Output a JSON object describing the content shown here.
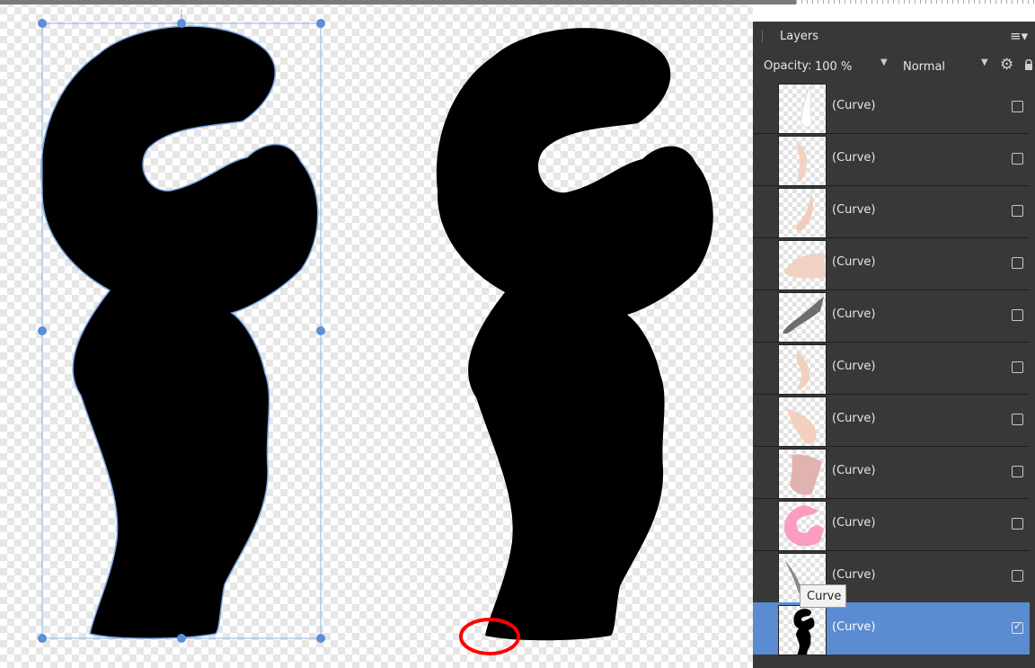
{
  "layers_panel": {
    "title": "Layers",
    "opacity_label": "Opacity:",
    "opacity_value": "100 %",
    "blend_mode": "Normal",
    "layers": [
      {
        "name": "(Curve)",
        "thumb_color": "#ffffff",
        "visible": false,
        "selected": false
      },
      {
        "name": "(Curve)",
        "thumb_color": "#f2d3c2",
        "visible": false,
        "selected": false
      },
      {
        "name": "(Curve)",
        "thumb_color": "#f1cdb9",
        "visible": false,
        "selected": false
      },
      {
        "name": "(Curve)",
        "thumb_color": "#f0d2c2",
        "visible": false,
        "selected": false
      },
      {
        "name": "(Curve)",
        "thumb_color": "#6e6e6e",
        "visible": false,
        "selected": false
      },
      {
        "name": "(Curve)",
        "thumb_color": "#f1d0bf",
        "visible": false,
        "selected": false
      },
      {
        "name": "(Curve)",
        "thumb_color": "#f2d0bd",
        "visible": false,
        "selected": false
      },
      {
        "name": "(Curve)",
        "thumb_color": "#e0b3b1",
        "visible": false,
        "selected": false
      },
      {
        "name": "(Curve)",
        "thumb_color": "#fb9cc0",
        "visible": false,
        "selected": false
      },
      {
        "name": "(Curve)",
        "thumb_color": "#888888",
        "visible": false,
        "selected": false
      },
      {
        "name": "(Curve)",
        "thumb_color": "#000000",
        "visible": true,
        "selected": true
      }
    ]
  },
  "tooltip": "Curve",
  "colors": {
    "panel_bg": "#383838",
    "selection_blue": "#5b8bd0",
    "bbox_handle": "#5b8fd6",
    "annotation_red": "#ff0000"
  }
}
